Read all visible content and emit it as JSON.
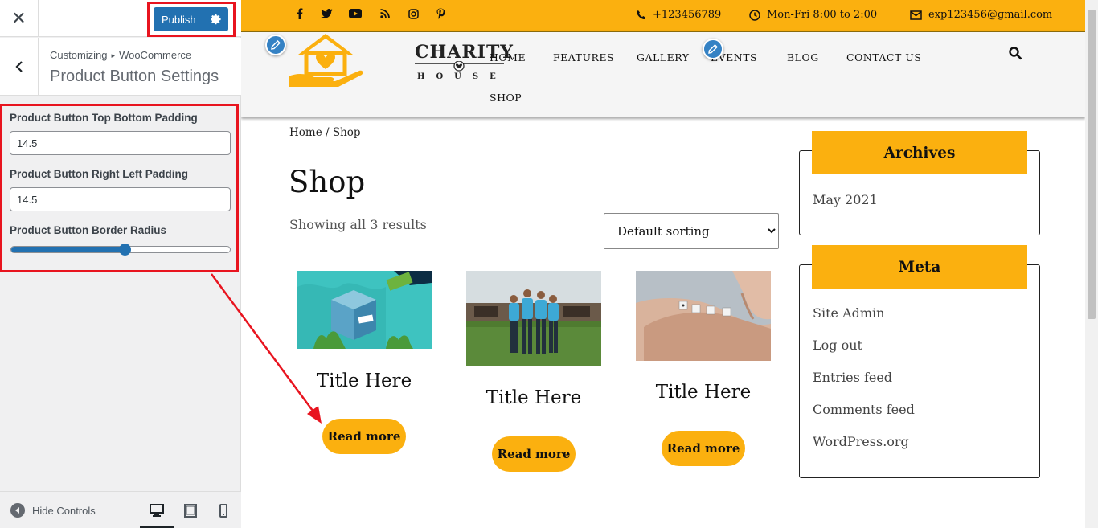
{
  "customizer": {
    "publish_label": "Publish",
    "breadcrumb_root": "Customizing",
    "breadcrumb_separator": "▸",
    "breadcrumb_section": "WooCommerce",
    "section_title": "Product Button Settings",
    "controls": {
      "top_bottom_label": "Product Button Top Bottom Padding",
      "top_bottom_value": "14.5",
      "right_left_label": "Product Button Right Left Padding",
      "right_left_value": "14.5",
      "radius_label": "Product Button Border Radius",
      "radius_fraction": 0.52
    },
    "hide_controls_label": "Hide Controls",
    "devices": [
      "desktop-icon",
      "tablet-icon",
      "mobile-icon"
    ],
    "active_device": "desktop"
  },
  "site": {
    "accent": "#fbb00f",
    "topbar": {
      "social": [
        "facebook-icon",
        "twitter-icon",
        "youtube-icon",
        "rss-icon",
        "instagram-icon",
        "pinterest-icon"
      ],
      "phone": "+123456789",
      "hours": "Mon-Fri 8:00 to 2:00",
      "email": "exp123456@gmail.com"
    },
    "logo": {
      "word": "CHARITY",
      "sub": "HOUSE"
    },
    "nav": {
      "home": "HOME",
      "features": "FEATURES",
      "gallery": "GALLERY",
      "events": "EVENTS",
      "blog": "BLOG",
      "contact": "CONTACT US",
      "shop": "SHOP"
    },
    "breadcrumb": "Home / Shop",
    "page_title": "Shop",
    "results_text": "Showing all 3 results",
    "sorting": {
      "selected": "Default sorting"
    },
    "products": [
      {
        "title": "Title Here",
        "button": "Read more"
      },
      {
        "title": "Title Here",
        "button": "Read more"
      },
      {
        "title": "Title Here",
        "button": "Read more"
      }
    ],
    "widgets": {
      "archives_title": "Archives",
      "archives": [
        "May 2021"
      ],
      "meta_title": "Meta",
      "meta": [
        "Site Admin",
        "Log out",
        "Entries feed",
        "Comments feed",
        "WordPress.org"
      ]
    }
  }
}
